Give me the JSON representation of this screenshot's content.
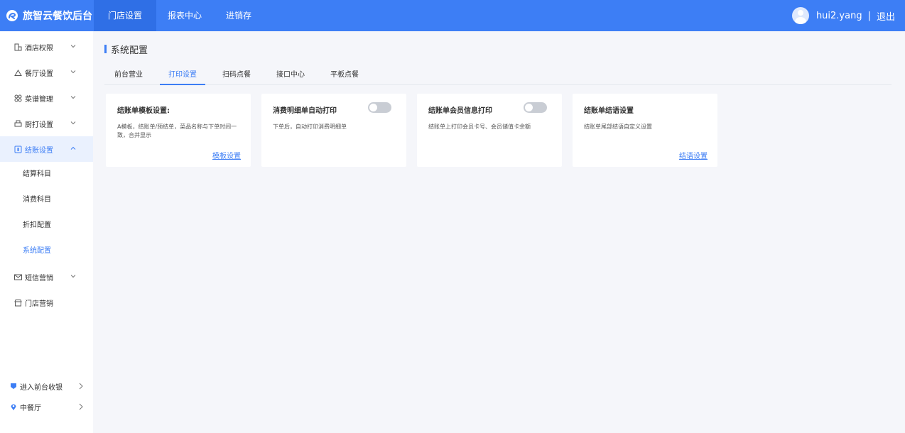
{
  "brand": {
    "name": "旅智云餐饮后台"
  },
  "topnav": [
    {
      "label": "门店设置",
      "active": true
    },
    {
      "label": "报表中心",
      "active": false
    },
    {
      "label": "进销存",
      "active": false
    }
  ],
  "user": {
    "name": "hui2.yang",
    "separator": "|",
    "logout": "退出"
  },
  "sidebar": {
    "items": [
      {
        "label": "酒店权限",
        "icon": "building-icon"
      },
      {
        "label": "餐厅设置",
        "icon": "home-icon"
      },
      {
        "label": "菜谱管理",
        "icon": "grid-icon"
      },
      {
        "label": "厨打设置",
        "icon": "printer-icon"
      },
      {
        "label": "结账设置",
        "icon": "receipt-icon",
        "open": true
      }
    ],
    "subitems": [
      {
        "label": "结算科目"
      },
      {
        "label": "消费科目"
      },
      {
        "label": "折扣配置"
      },
      {
        "label": "系统配置",
        "active": true
      }
    ],
    "more_items": [
      {
        "label": "短信营销",
        "icon": "mail-icon"
      },
      {
        "label": "门店营销",
        "icon": "store-icon"
      }
    ],
    "bottom": [
      {
        "label": "进入前台收银",
        "icon": "shield-icon"
      },
      {
        "label": "中餐厅",
        "icon": "location-icon"
      }
    ]
  },
  "page": {
    "title": "系统配置"
  },
  "tabs": [
    {
      "label": "前台营业"
    },
    {
      "label": "打印设置",
      "active": true
    },
    {
      "label": "扫码点餐"
    },
    {
      "label": "接口中心"
    },
    {
      "label": "平板点餐"
    }
  ],
  "cards": [
    {
      "title": "结账单模板设置:",
      "desc": "A模板，结账单/预结单，菜品名称与下单时间一致，合并显示",
      "link": "模板设置"
    },
    {
      "title": "消费明细单自动打印",
      "desc": "下单后，自动打印消费明细单",
      "toggle": false
    },
    {
      "title": "结账单会员信息打印",
      "desc": "结账单上打印会员卡号、会员储值卡余额",
      "toggle": false
    },
    {
      "title": "结账单结语设置",
      "desc": "结账单尾部结语自定义设置",
      "link": "结语设置"
    }
  ],
  "colors": {
    "primary": "#3d7ef5",
    "active_nav": "#2f6fe6",
    "background": "#f5f6fa",
    "toggle_off": "#c9cdd4"
  }
}
